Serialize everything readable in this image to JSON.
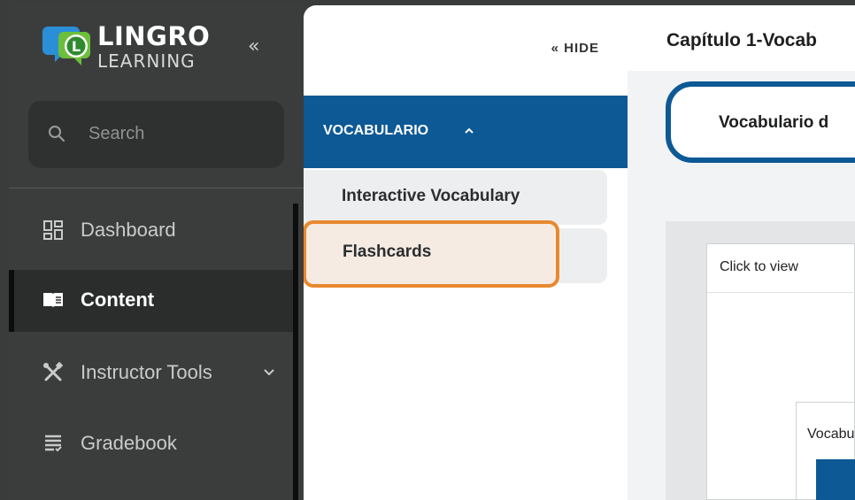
{
  "brand": {
    "name_line1": "LINGRO",
    "name_line2": "LEARNING",
    "colors": {
      "primary": "#0d5995",
      "accent_orange": "#e8892f",
      "logo_blue": "#2a8fd6",
      "logo_green": "#6cbf3a"
    }
  },
  "sidebar": {
    "collapse_icon": "double-chevron-left-icon",
    "search": {
      "placeholder": "Search"
    },
    "items": [
      {
        "label": "Dashboard",
        "icon": "dashboard-grid-icon",
        "active": false
      },
      {
        "label": "Content",
        "icon": "book-icon",
        "active": true
      },
      {
        "label": "Instructor Tools",
        "icon": "tools-icon",
        "active": false,
        "has_dropdown": true
      },
      {
        "label": "Gradebook",
        "icon": "gradebook-icon",
        "active": false
      }
    ]
  },
  "panel": {
    "hide_label": "« HIDE",
    "section": {
      "label": "VOCABULARIO",
      "expanded": true
    },
    "items": [
      {
        "label": "Interactive Vocabulary"
      },
      {
        "label": "Flashcards",
        "highlighted": true
      }
    ]
  },
  "content": {
    "chapter_title": "Capítulo 1-Vocab",
    "tab_label": "Vocabulario d",
    "card_text": "Click to view",
    "inner_card_text": "Vocabu"
  }
}
